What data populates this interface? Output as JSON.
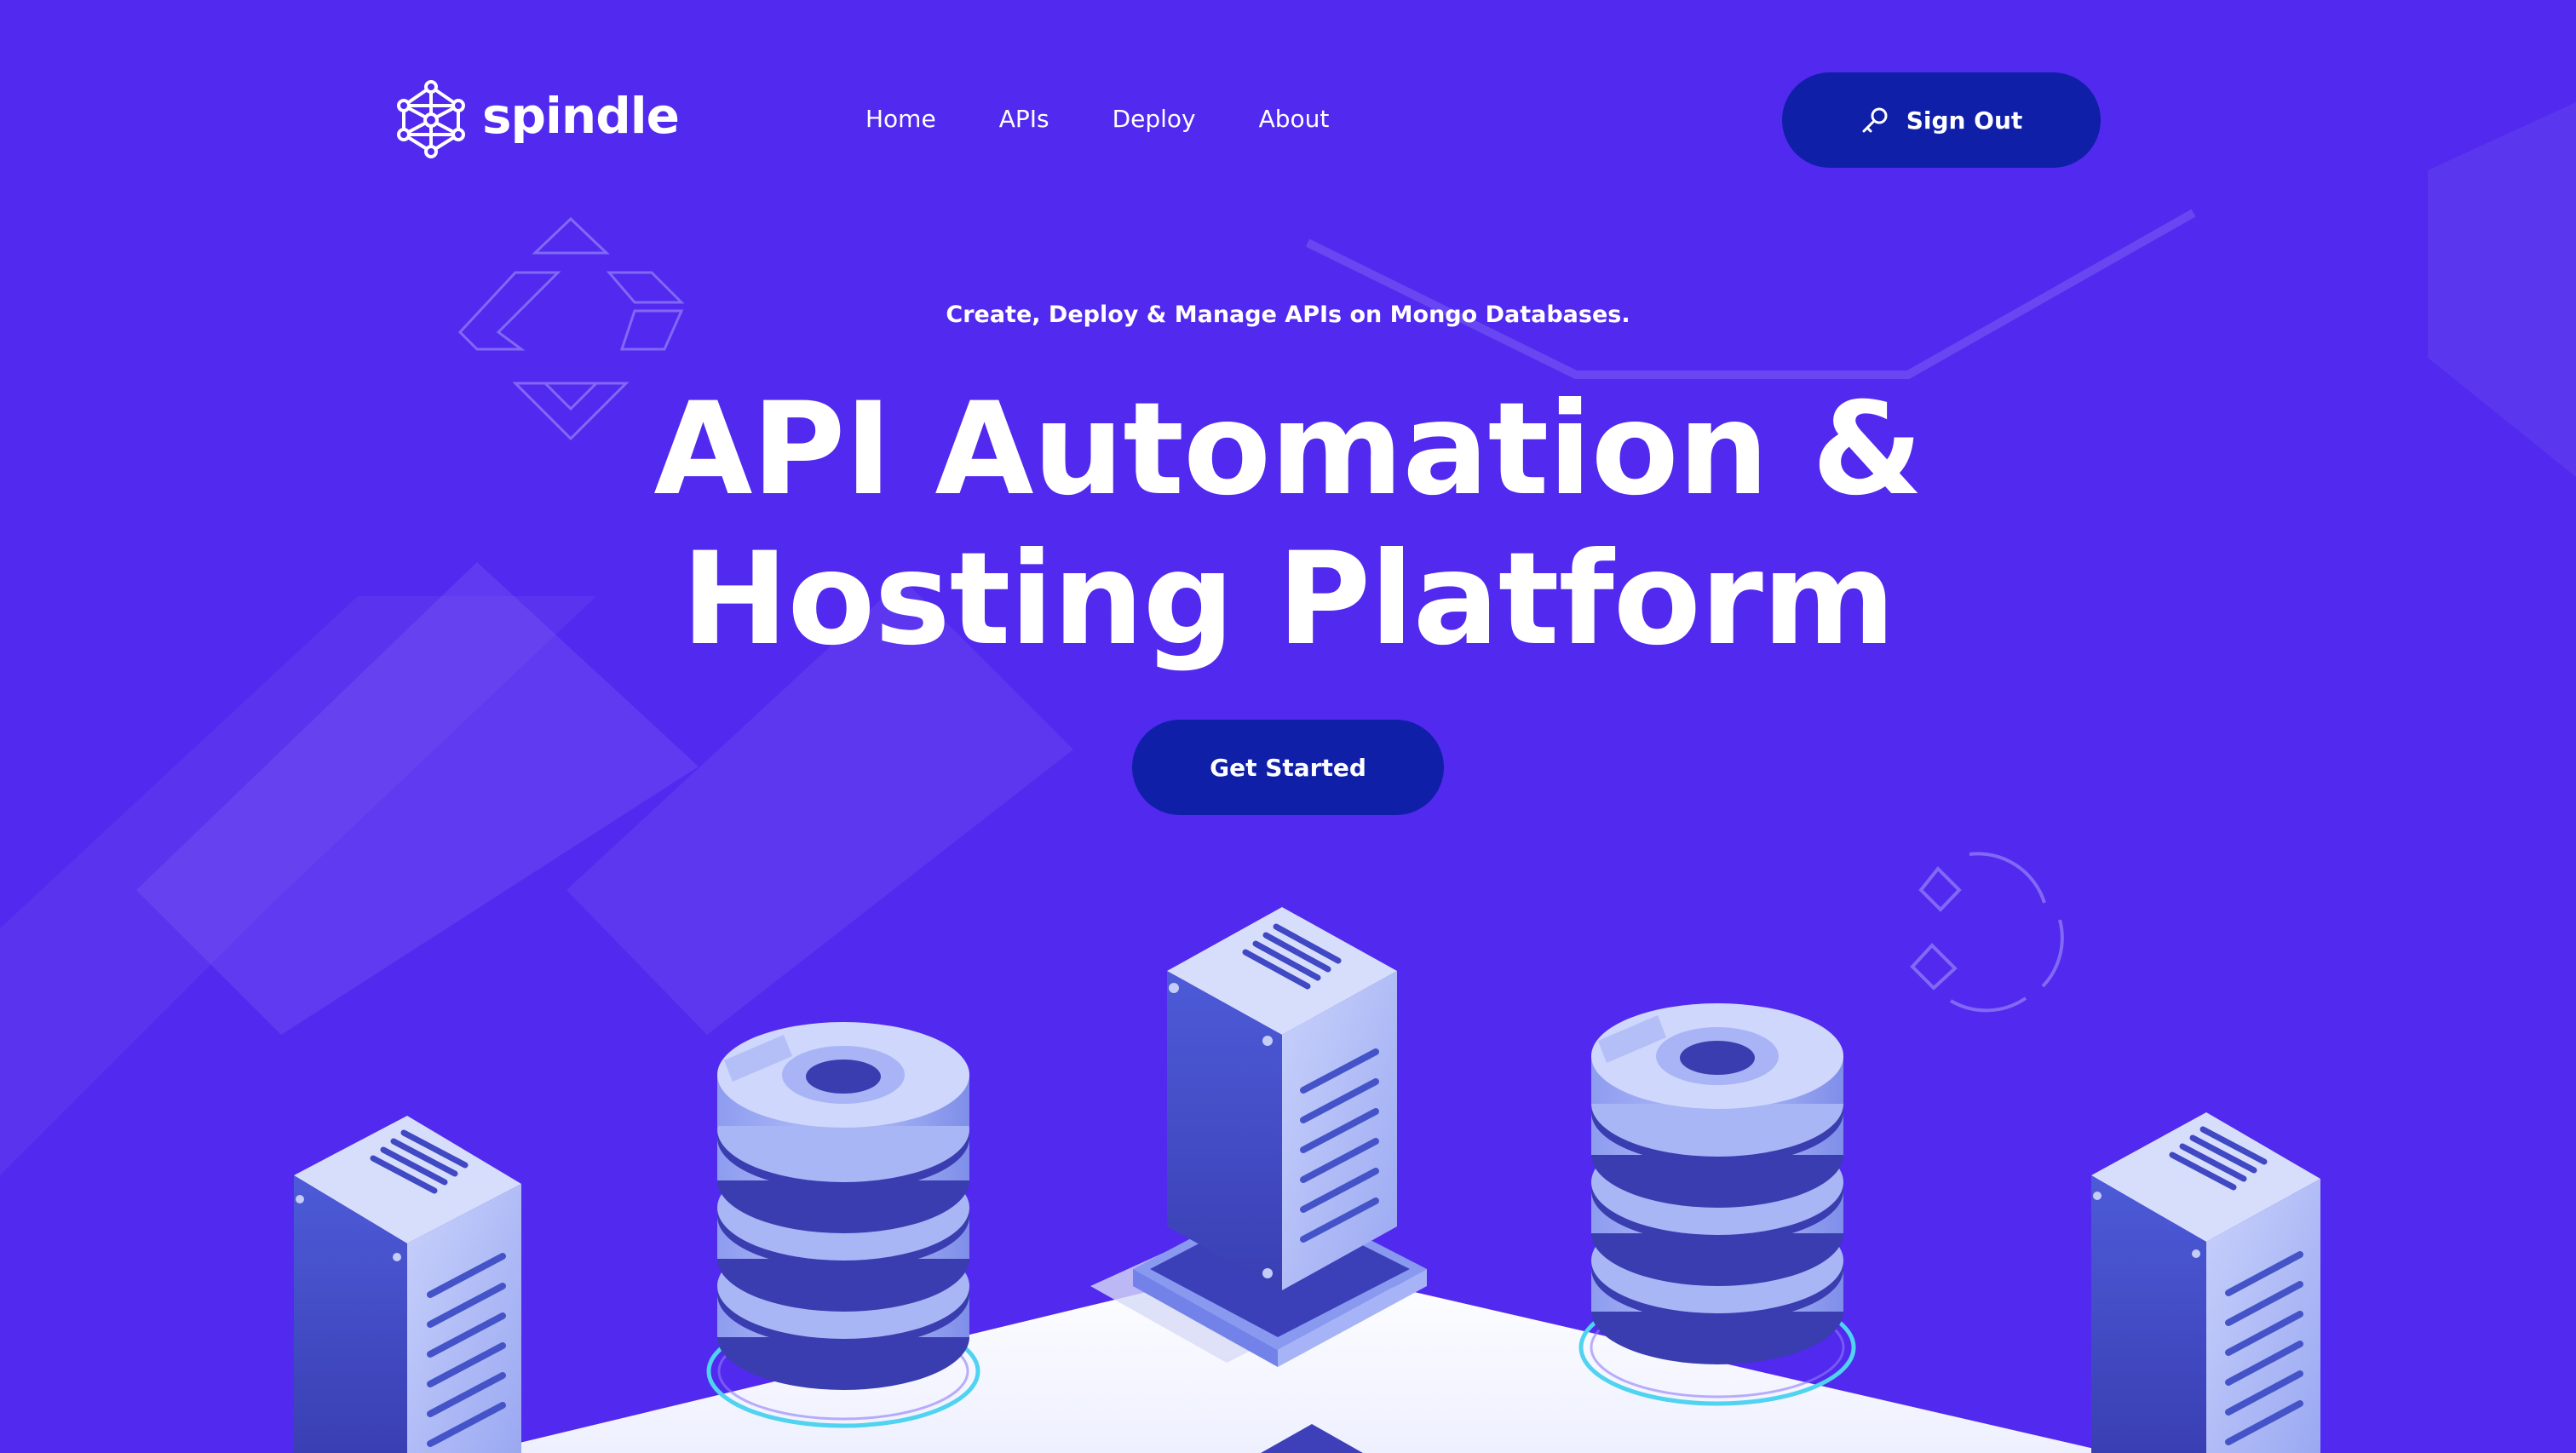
{
  "brand": {
    "name": "spindle",
    "logo_icon": "molecule-network-icon"
  },
  "nav": {
    "items": [
      {
        "label": "Home"
      },
      {
        "label": "APIs"
      },
      {
        "label": "Deploy"
      },
      {
        "label": "About"
      }
    ]
  },
  "header": {
    "signout_label": "Sign Out",
    "signout_icon": "key-icon"
  },
  "hero": {
    "subtitle": "Create, Deploy & Manage APIs on Mongo Databases.",
    "headline_line1": "API Automation &",
    "headline_line2": "Hosting Platform",
    "cta_label": "Get Started"
  },
  "colors": {
    "background": "#5229ee",
    "button": "#0f1fa8",
    "text": "#ffffff",
    "server_light": "#a9b6f5",
    "server_dark": "#3c3fb8",
    "floor": "#ffffff",
    "ring": "#4fd3f0"
  }
}
